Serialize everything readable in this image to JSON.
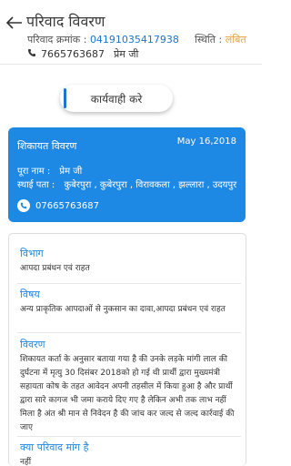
{
  "header": {
    "title": "परिवाद विवरण",
    "complaint_number_label": "परिवाद क्रमांक :",
    "complaint_number": "04191035417938",
    "status_label": "स्थिति :",
    "status_value": "लंबित",
    "phone": "7665763687",
    "name": "प्रेम जी"
  },
  "action_button": {
    "label": "कार्यवाही करे"
  },
  "card": {
    "heading": "शिकायत विवरण",
    "date": "May 16,2018",
    "full_name_label": "पूरा नाम :",
    "full_name": "प्रेम जी",
    "address_label": "स्थाई पता :",
    "address": "कुबेरपुरा , कुबेरपुरा , विरावकला , झल्लारा , उदयपुर",
    "phone": "07665763687"
  },
  "details": {
    "department_label": "विभाग",
    "department_value": "आपदा प्रबंधन एवं राहत",
    "subject_label": "विषय",
    "subject_value": "अन्य प्राकृतिक आपदाओं से नुकसान का दावा,आपदा प्रबंधन एवं राहत",
    "description_label": "विवरण",
    "description_value": "शिकायत कर्ता के अनुसार बताया गया है की उनके लड़के मांगी लाल की दुर्घटना में मृत्यु 30 दिसंबर 2018को हो गई थी प्रार्थी द्वारा मुख्यमंत्री सहायता कोष के तहत आवेदन अपनी तहसील में किया हुआ है और प्रार्थी द्वारा सारे कागज भी जमा कराये दिए गए है लेकिन अभी तक लाभ नहीं मिला है अंत श्री मान से निवेदन है की जांच कर जल्द से जल्द कार्रवाई की जाए",
    "request_label": "क्या परिवाद मांग है",
    "request_value": "नहीं"
  },
  "colors": {
    "accent": "#1e88e5",
    "status": "#e8a23b"
  }
}
